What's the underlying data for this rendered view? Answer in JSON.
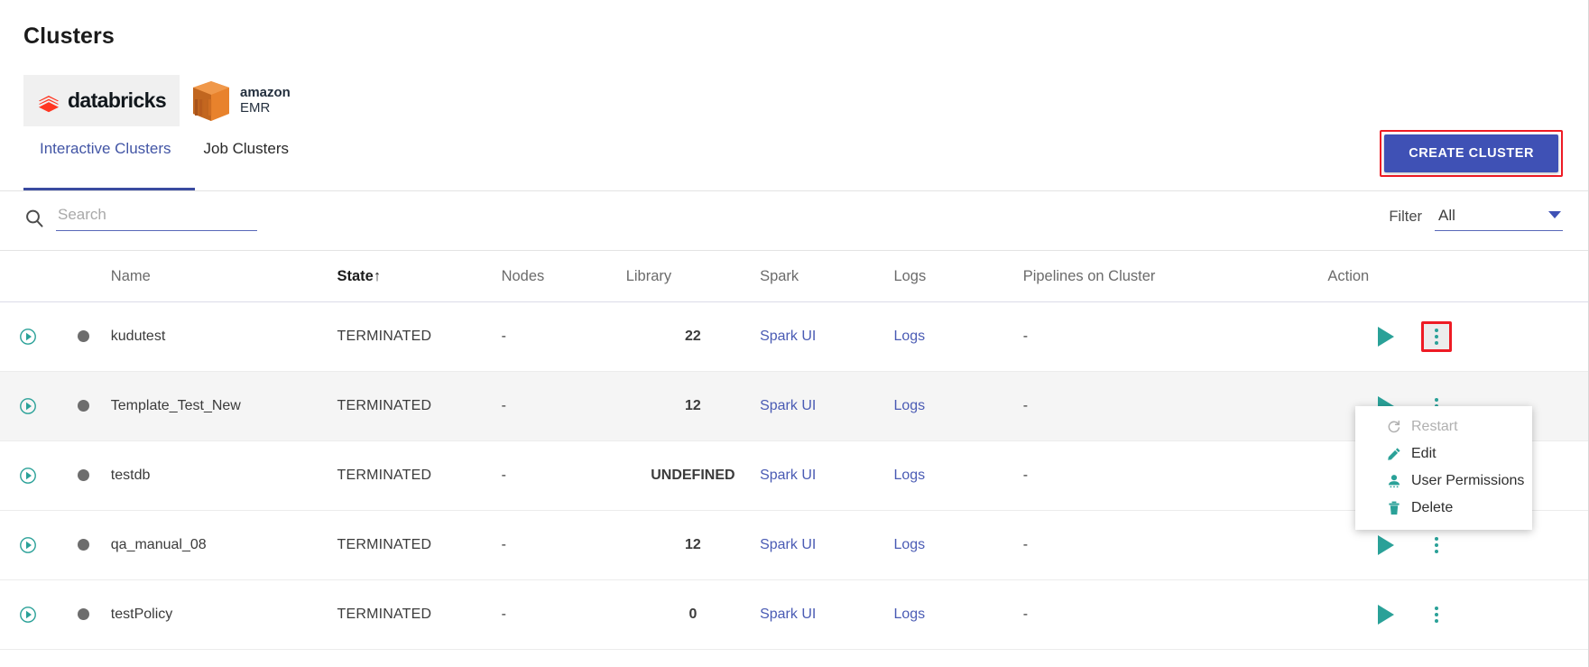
{
  "page": {
    "title": "Clusters"
  },
  "providers": [
    {
      "id": "databricks",
      "label": "databricks",
      "selected": true
    },
    {
      "id": "amazon-emr",
      "label_top": "amazon",
      "label_bottom": "EMR",
      "selected": false
    }
  ],
  "tabs": [
    {
      "id": "interactive-clusters",
      "label": "Interactive Clusters",
      "active": true
    },
    {
      "id": "job-clusters",
      "label": "Job Clusters",
      "active": false
    }
  ],
  "toolbar": {
    "create_label": "CREATE CLUSTER",
    "create_highlight_color": "#ee1b24",
    "create_bg_color": "#3f51b5"
  },
  "search": {
    "placeholder": "Search",
    "value": "",
    "icon": "search-icon"
  },
  "filter": {
    "label": "Filter",
    "value": "All",
    "icon": "chevron-down-icon"
  },
  "table": {
    "columns": [
      {
        "key": "expand",
        "label": ""
      },
      {
        "key": "status",
        "label": ""
      },
      {
        "key": "name",
        "label": "Name"
      },
      {
        "key": "state",
        "label": "State",
        "sorted": true,
        "sort_indicator": "↑"
      },
      {
        "key": "nodes",
        "label": "Nodes"
      },
      {
        "key": "library",
        "label": "Library"
      },
      {
        "key": "spark",
        "label": "Spark"
      },
      {
        "key": "logs",
        "label": "Logs"
      },
      {
        "key": "pipelines",
        "label": "Pipelines on Cluster"
      },
      {
        "key": "action",
        "label": "Action"
      }
    ],
    "rows": [
      {
        "name": "kudutest",
        "state": "TERMINATED",
        "nodes": "-",
        "library": "22",
        "spark": "Spark UI",
        "logs": "Logs",
        "pipelines": "-",
        "highlighted": false,
        "menu_open": true
      },
      {
        "name": "Template_Test_New",
        "state": "TERMINATED",
        "nodes": "-",
        "library": "12",
        "spark": "Spark UI",
        "logs": "Logs",
        "pipelines": "-",
        "highlighted": true,
        "menu_open": false
      },
      {
        "name": "testdb",
        "state": "TERMINATED",
        "nodes": "-",
        "library": "UNDEFINED",
        "spark": "Spark UI",
        "logs": "Logs",
        "pipelines": "-",
        "highlighted": false,
        "menu_open": false
      },
      {
        "name": "qa_manual_08",
        "state": "TERMINATED",
        "nodes": "-",
        "library": "12",
        "spark": "Spark UI",
        "logs": "Logs",
        "pipelines": "-",
        "highlighted": false,
        "menu_open": false
      },
      {
        "name": "testPolicy",
        "state": "TERMINATED",
        "nodes": "-",
        "library": "0",
        "spark": "Spark UI",
        "logs": "Logs",
        "pipelines": "-",
        "highlighted": false,
        "menu_open": false
      }
    ]
  },
  "action_menu": {
    "items": [
      {
        "id": "restart",
        "label": "Restart",
        "icon": "restart-icon",
        "disabled": true
      },
      {
        "id": "edit",
        "label": "Edit",
        "icon": "pencil-icon",
        "disabled": false
      },
      {
        "id": "user-permissions",
        "label": "User Permissions",
        "icon": "user-icon",
        "disabled": false
      },
      {
        "id": "delete",
        "label": "Delete",
        "icon": "trash-icon",
        "disabled": false
      }
    ]
  },
  "colors": {
    "accent_teal": "#2aa198",
    "link_blue": "#4a5bb4",
    "primary_blue": "#3f51b5",
    "highlight_red": "#ee1b24"
  }
}
